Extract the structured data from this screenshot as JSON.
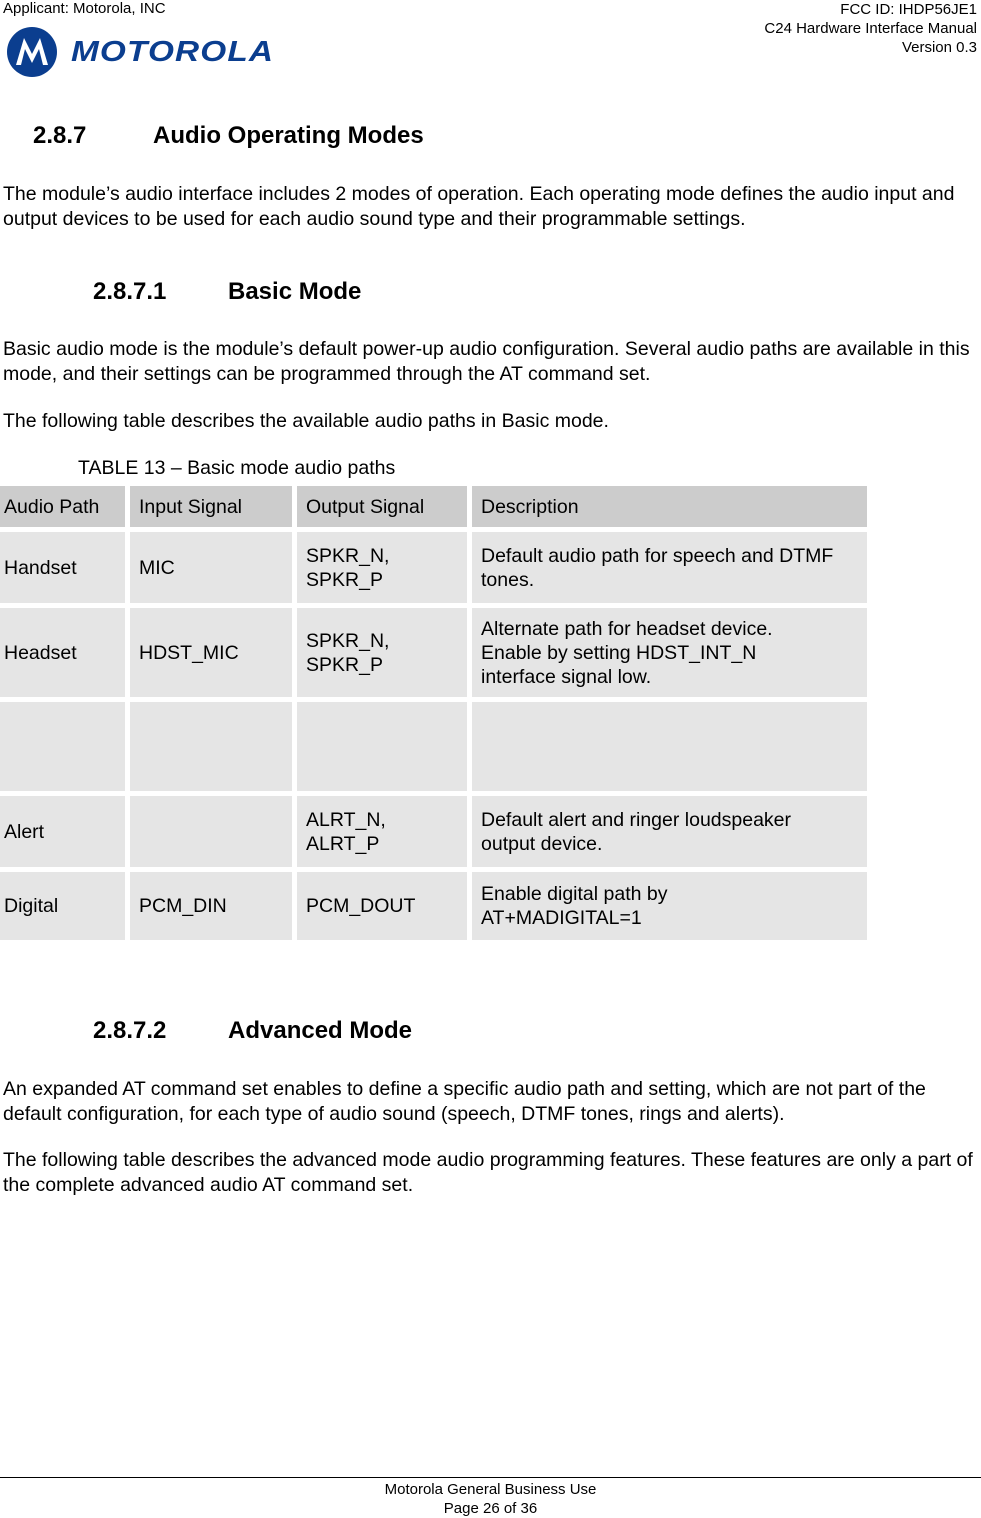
{
  "header": {
    "applicant": "Applicant: Motorola, INC",
    "fcc_id": "FCC ID: IHDP56JE1",
    "manual": "C24 Hardware Interface Manual",
    "version": "Version 0.3",
    "logo_text": "MOTOROLA",
    "brand_color": "#0b3e8f"
  },
  "section": {
    "number": "2.8.7",
    "title": "Audio Operating Modes",
    "intro": "The module’s audio interface includes 2 modes of operation. Each operating mode defines the audio input and output devices to be used for each audio sound type and their programmable settings."
  },
  "basic": {
    "number": "2.8.7.1",
    "title": "Basic Mode",
    "para1": "Basic audio mode is the module’s default power-up audio configuration. Several audio paths are available in this mode, and their settings can be programmed through the AT command set.",
    "para2": "The following table describes the available audio paths in Basic mode.",
    "table_caption": "TABLE 13 – Basic mode audio paths",
    "table": {
      "headers": [
        "Audio Path",
        "Input Signal",
        "Output Signal",
        "Description"
      ],
      "rows": [
        [
          "Handset",
          "MIC",
          "SPKR_N,\nSPKR_P",
          "Default audio path for speech and DTMF tones."
        ],
        [
          "Headset",
          "HDST_MIC",
          "SPKR_N,\nSPKR_P",
          "Alternate path for headset device.\nEnable by setting HDST_INT_N\ninterface signal low."
        ],
        [
          "",
          "",
          "",
          ""
        ],
        [
          "Alert",
          "",
          "ALRT_N,\nALRT_P",
          "Default alert and ringer loudspeaker\noutput device."
        ],
        [
          "Digital",
          "PCM_DIN",
          "PCM_DOUT",
          "Enable digital path by\nAT+MADIGITAL=1"
        ]
      ]
    }
  },
  "advanced": {
    "number": "2.8.7.2",
    "title": "Advanced Mode",
    "para1": "An expanded AT command set enables to define a specific audio path and setting, which are not part of the default configuration, for each type of audio sound (speech, DTMF tones, rings and alerts).",
    "para2": "The following table describes the advanced mode audio programming features. These features are only a part of the complete advanced audio AT command set."
  },
  "footer": {
    "line1": "Motorola General Business Use",
    "line2": "Page 26 of 36"
  }
}
